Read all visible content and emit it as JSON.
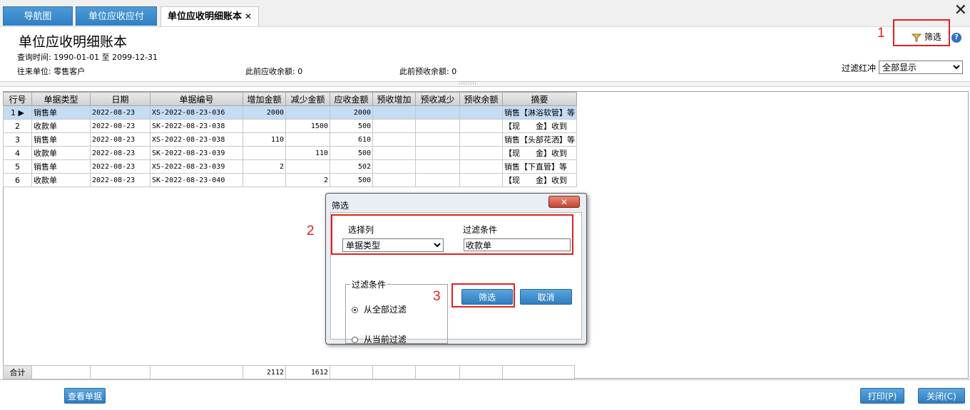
{
  "tabs": [
    {
      "label": "导航图"
    },
    {
      "label": "单位应收应付"
    },
    {
      "label": "单位应收明细账本",
      "close": "✕"
    }
  ],
  "header": {
    "title": "单位应收明细账本",
    "query_time": "查询时间: 1990-01-01 至 2099-12-31",
    "partner": "往来单位: 零售客户",
    "prev_receivable": "此前应收余额: 0",
    "prev_prepaid": "此前预收余额: 0",
    "filter_btn": "筛选",
    "filter_red_label": "过滤红冲",
    "filter_red_value": "全部显示"
  },
  "annotations": [
    "1",
    "2",
    "3"
  ],
  "grid": {
    "headers": [
      "行号",
      "单据类型",
      "日期",
      "单据编号",
      "增加金额",
      "减少金额",
      "应收金额",
      "预收增加",
      "预收减少",
      "预收余额",
      "摘要"
    ],
    "rows": [
      [
        "1",
        "销售单",
        "2022-08-23",
        "XS-2022-08-23-036",
        "2000",
        "",
        "2000",
        "",
        "",
        "",
        "销售【淋浴软管】等"
      ],
      [
        "2",
        "收款单",
        "2022-08-23",
        "SK-2022-08-23-038",
        "",
        "1500",
        "500",
        "",
        "",
        "",
        "【现　　金】收到"
      ],
      [
        "3",
        "销售单",
        "2022-08-23",
        "XS-2022-08-23-038",
        "110",
        "",
        "610",
        "",
        "",
        "",
        "销售【头部花洒】等"
      ],
      [
        "4",
        "收款单",
        "2022-08-23",
        "SK-2022-08-23-039",
        "",
        "110",
        "500",
        "",
        "",
        "",
        "【现　　金】收到"
      ],
      [
        "5",
        "销售单",
        "2022-08-23",
        "XS-2022-08-23-039",
        "2",
        "",
        "502",
        "",
        "",
        "",
        "销售【下直管】等"
      ],
      [
        "6",
        "收款单",
        "2022-08-23",
        "SK-2022-08-23-040",
        "",
        "2",
        "500",
        "",
        "",
        "",
        "【现　　金】收到"
      ]
    ],
    "footer": [
      "合计",
      "",
      "",
      "",
      "2112",
      "1612",
      "",
      "",
      "",
      "",
      ""
    ]
  },
  "bottom": {
    "view_doc": "查看单据",
    "print": "打印(P)",
    "close": "关闭(C)"
  },
  "dialog": {
    "title": "筛选",
    "close": "✕",
    "col_label": "选择列",
    "col_value": "单据类型",
    "cond_label": "过滤条件",
    "cond_value": "收款单",
    "group_label": "过滤条件",
    "radio_all": "从全部过滤",
    "radio_current": "从当前过滤",
    "ok": "筛选",
    "cancel": "取消"
  }
}
